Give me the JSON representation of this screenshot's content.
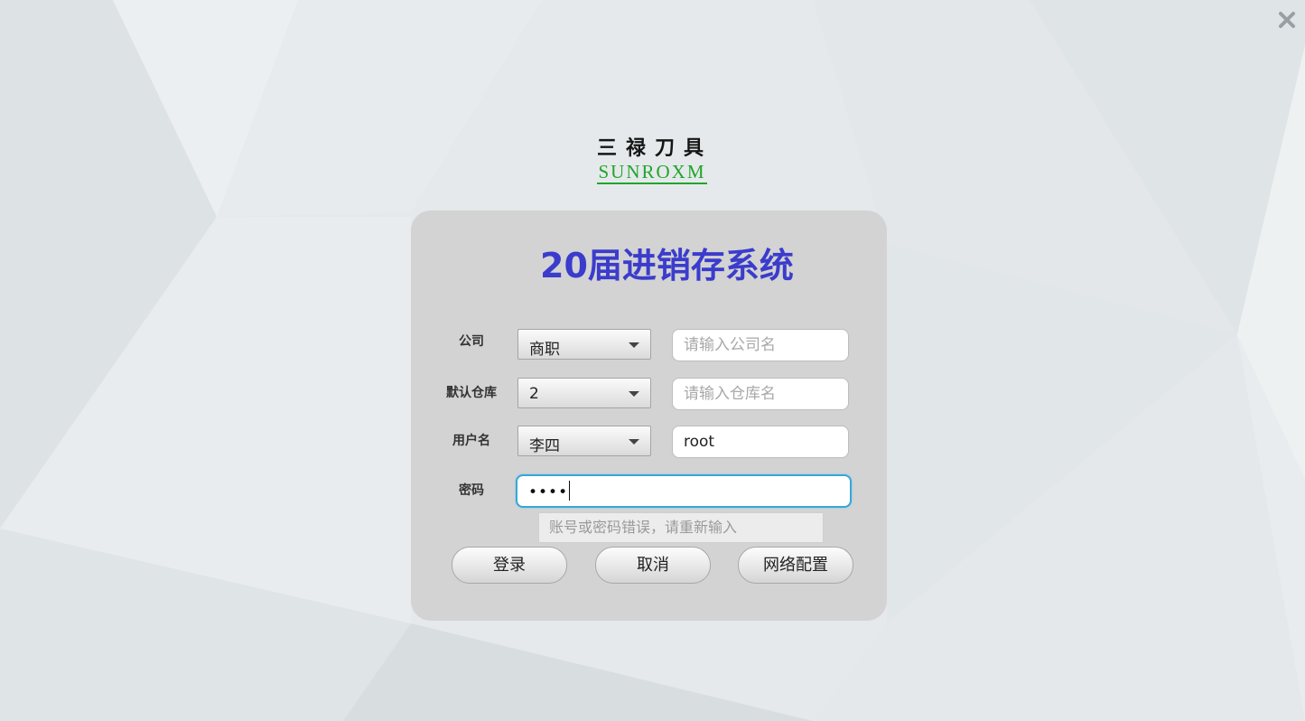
{
  "window": {
    "close_icon": "close-icon"
  },
  "logo": {
    "chinese": "三禄刀具",
    "english": "SUNROXM",
    "brand_color": "#21a52c"
  },
  "title": "20届进销存系统",
  "title_color": "#3b3ccc",
  "form": {
    "company": {
      "label": "公司",
      "selected": "商职",
      "placeholder": "请输入公司名",
      "value": ""
    },
    "warehouse": {
      "label": "默认仓库",
      "selected": "2",
      "placeholder": "请输入仓库名",
      "value": ""
    },
    "username": {
      "label": "用户名",
      "selected": "李四",
      "value": "root"
    },
    "password": {
      "label": "密码",
      "masked_value": "••••"
    },
    "error_message": "账号或密码错误，请重新输入"
  },
  "buttons": {
    "login": "登录",
    "cancel": "取消",
    "network_config": "网络配置"
  },
  "colors": {
    "focus_border": "#38a6d6",
    "panel_bg": "#d3d3d3"
  }
}
